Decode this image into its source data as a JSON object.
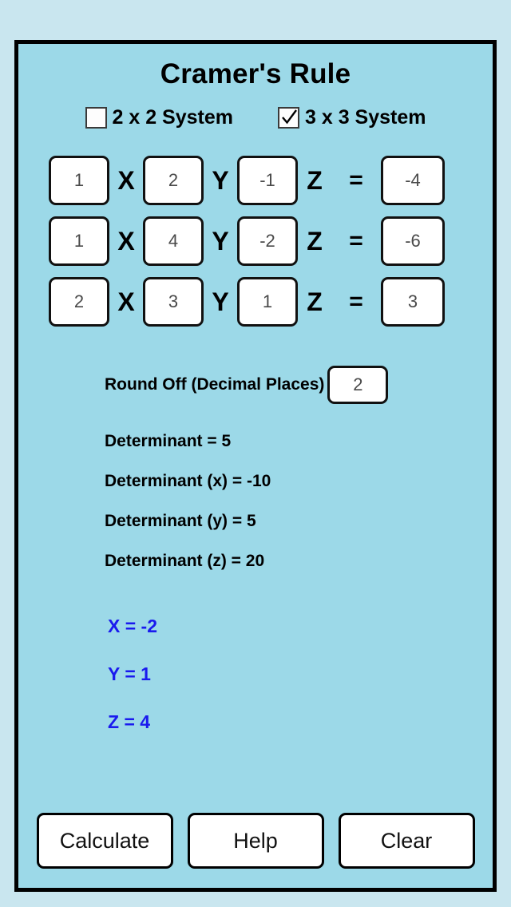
{
  "app": {
    "title": "Cramer's Rule",
    "panel_bg": "#9cd9e8",
    "page_bg": "#c9e6ef",
    "result_color": "#1a1aee"
  },
  "system_modes": [
    {
      "label": "2 x 2 System",
      "checked": false,
      "icon": "checkbox-empty-icon"
    },
    {
      "label": "3 x 3 System",
      "checked": true,
      "icon": "checkbox-checked-icon"
    }
  ],
  "equations": [
    {
      "x_coeff": "1",
      "x_label": "X",
      "y_coeff": "2",
      "y_label": "Y",
      "z_coeff": "-1",
      "z_label": "Z",
      "equals": "=",
      "rhs": "-4"
    },
    {
      "x_coeff": "1",
      "x_label": "X",
      "y_coeff": "4",
      "y_label": "Y",
      "z_coeff": "-2",
      "z_label": "Z",
      "equals": "=",
      "rhs": "-6"
    },
    {
      "x_coeff": "2",
      "x_label": "X",
      "y_coeff": "3",
      "y_label": "Y",
      "z_coeff": "1",
      "z_label": "Z",
      "equals": "=",
      "rhs": "3"
    }
  ],
  "round_off": {
    "label": "Round Off (Decimal Places)",
    "value": "2"
  },
  "determinants": [
    "Determinant = 5",
    "Determinant (x) = -10",
    "Determinant (y) = 5",
    "Determinant (z) = 20"
  ],
  "solutions": [
    "X = -2",
    "Y = 1",
    "Z = 4"
  ],
  "buttons": [
    {
      "label": "Calculate",
      "name": "calculate-button"
    },
    {
      "label": "Help",
      "name": "help-button"
    },
    {
      "label": "Clear",
      "name": "clear-button"
    }
  ]
}
